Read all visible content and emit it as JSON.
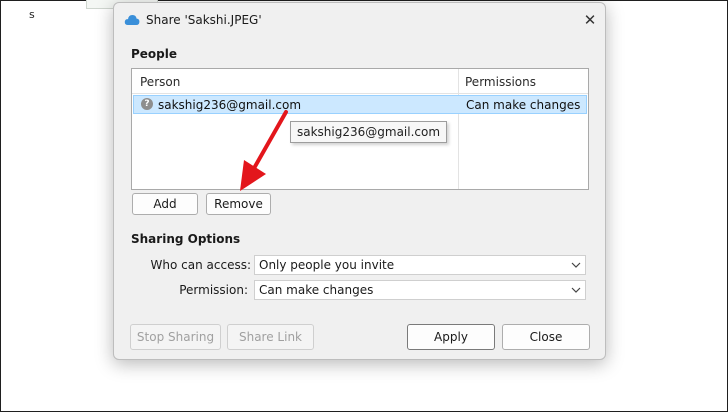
{
  "background": {
    "fragment_top": "",
    "fragment_second": "s"
  },
  "dialog": {
    "title": "Share 'Sakshi.JPEG'",
    "close_glyph": "✕",
    "people": {
      "section_label": "People",
      "columns": [
        "Person",
        "Permissions"
      ],
      "rows": [
        {
          "person": "sakshig236@gmail.com",
          "permission": "Can make changes",
          "selected": true
        }
      ],
      "tooltip": "sakshig236@gmail.com"
    },
    "people_buttons": {
      "add": "Add",
      "remove": "Remove"
    },
    "sharing_options": {
      "section_label": "Sharing Options",
      "who_can_access_label": "Who can access:",
      "who_can_access_value": "Only people you invite",
      "permission_label": "Permission:",
      "permission_value": "Can make changes"
    },
    "footer": {
      "stop_sharing": "Stop Sharing",
      "share_link": "Share Link",
      "apply": "Apply",
      "close": "Close"
    }
  },
  "colors": {
    "selection": "#cce8ff",
    "annotation_arrow": "#e3161c",
    "cloud_icon": "#3a8fd9"
  },
  "icons": {
    "title": "cloud-icon",
    "person": "person-question-icon",
    "combo": "chevron-down-icon"
  }
}
